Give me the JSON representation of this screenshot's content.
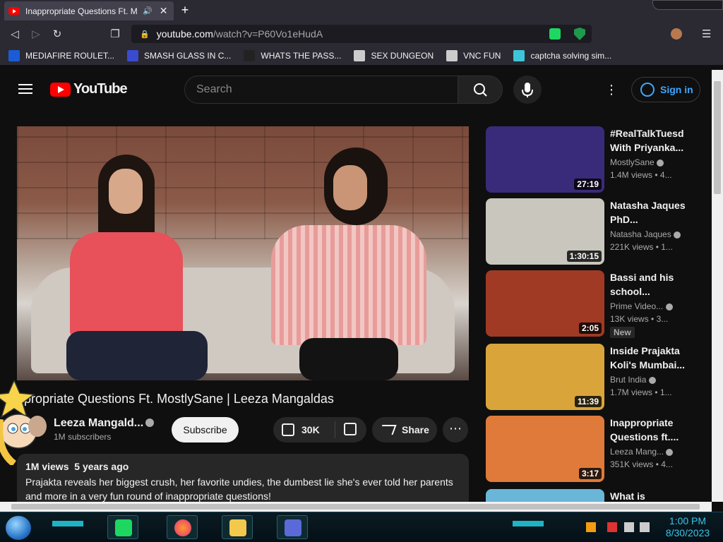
{
  "browser": {
    "tab_title": "Inappropriate Questions Ft. M",
    "url_host": "youtube.com",
    "url_path": "/watch?v=P60Vo1eHudA",
    "bookmarks": [
      {
        "label": "MEDIAFIRE ROULET...",
        "color": "#1b5cd6"
      },
      {
        "label": "SMASH GLASS IN C...",
        "color": "#3b4bd0"
      },
      {
        "label": "WHATS THE PASS...",
        "color": "#222222"
      },
      {
        "label": "SEX DUNGEON",
        "color": "#cccccc"
      },
      {
        "label": "VNC FUN",
        "color": "#cccccc"
      },
      {
        "label": "captcha solving sim...",
        "color": "#3dc6d8"
      }
    ]
  },
  "youtube": {
    "logo_text": "YouTube",
    "search_placeholder": "Search",
    "signin_label": "Sign in"
  },
  "video": {
    "title": "ppropriate Questions Ft. MostlySane | Leeza Mangaldas",
    "channel": "Leeza Mangald...",
    "subscribers": "1M subscribers",
    "subscribe_label": "Subscribe",
    "likes": "30K",
    "share_label": "Share",
    "views": "1M views",
    "age": "5 years ago",
    "description": "Prajakta reveals her biggest crush, her favorite undies, the dumbest lie she's ever told her parents and more in a very fun round of inappropriate questions!"
  },
  "recommendations": [
    {
      "title": "#RealTalkTuesd With Priyanka...",
      "channel": "MostlySane",
      "views": "1.4M views",
      "sep": "• 4...",
      "duration": "27:19",
      "thumb": "#3a2b7a",
      "badge": ""
    },
    {
      "title": "Natasha Jaques PhD...",
      "channel": "Natasha Jaques",
      "views": "221K views",
      "sep": "• 1...",
      "duration": "1:30:15",
      "thumb": "#c9c6bd",
      "badge": ""
    },
    {
      "title": "Bassi and his school...",
      "channel": "Prime Video...",
      "views": "13K views",
      "sep": "• 3...",
      "duration": "2:05",
      "thumb": "#a03a24",
      "badge": "New"
    },
    {
      "title": "Inside Prajakta Koli's Mumbai...",
      "channel": "Brut India",
      "views": "1.7M views",
      "sep": "• 1...",
      "duration": "11:39",
      "thumb": "#d9a53a",
      "badge": ""
    },
    {
      "title": "Inappropriate Questions ft....",
      "channel": "Leeza Mang...",
      "views": "351K views",
      "sep": "• 4...",
      "duration": "3:17",
      "thumb": "#e07a3a",
      "badge": ""
    },
    {
      "title": "What is",
      "channel": "",
      "views": "",
      "sep": "",
      "duration": "",
      "thumb": "#6ab6d8",
      "badge": ""
    }
  ],
  "taskbar": {
    "time": "1:00 PM",
    "date": "8/30/2023"
  }
}
